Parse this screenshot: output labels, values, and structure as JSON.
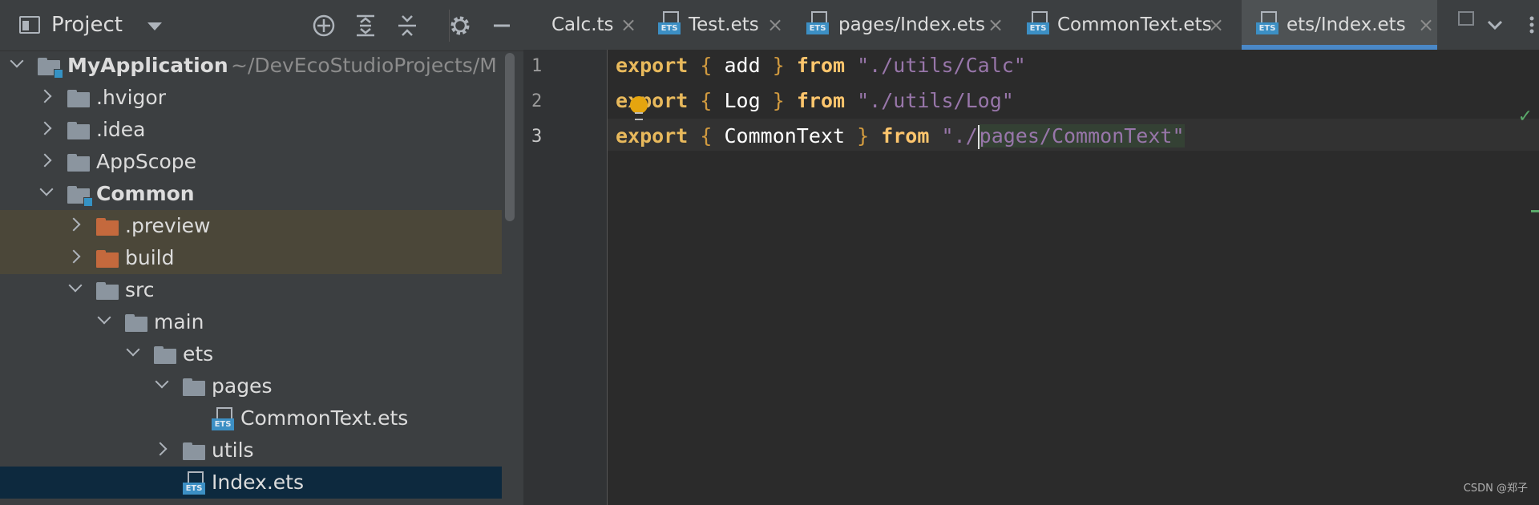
{
  "project_panel": {
    "title": "Project",
    "icons": {
      "view": "panel-icon",
      "dropdown": "chevron-down-icon",
      "locate": "crosshair-icon",
      "expand_all": "expand-all-icon",
      "collapse_all": "collapse-all-icon",
      "settings": "gear-icon",
      "hide": "minimize-icon"
    },
    "root": {
      "name": "MyApplication",
      "path": "~/DevEcoStudioProjects/M"
    },
    "items": [
      {
        "label": ".hvigor"
      },
      {
        "label": ".idea"
      },
      {
        "label": "AppScope"
      },
      {
        "label": "Common"
      },
      {
        "label": ".preview"
      },
      {
        "label": "build"
      },
      {
        "label": "src"
      },
      {
        "label": "main"
      },
      {
        "label": "ets"
      },
      {
        "label": "pages"
      },
      {
        "label": "CommonText.ets",
        "badge": "ETS"
      },
      {
        "label": "utils"
      },
      {
        "label": "Index.ets",
        "badge": "ETS"
      }
    ],
    "colors": {
      "excluded_folder": "#c4693d",
      "selection": "#0d293e",
      "highlight": "#4b4739"
    }
  },
  "editor": {
    "tabs": [
      {
        "label": "Calc.ts",
        "close": "×"
      },
      {
        "label": "Test.ets",
        "close": "×",
        "badge": "ETS"
      },
      {
        "label": "pages/Index.ets",
        "close": "×",
        "badge": "ETS"
      },
      {
        "label": "CommonText.ets",
        "close": "×",
        "badge": "ETS"
      },
      {
        "label": "ets/Index.ets",
        "close": "×",
        "badge": "ETS",
        "active": true
      }
    ],
    "more_tabs_icon": "chevron-down-icon",
    "active_tab_color": "#4a88c7",
    "line_numbers": [
      "1",
      "2",
      "3"
    ],
    "lines": [
      {
        "kw": "export",
        "open": "{",
        "name": "add",
        "close": "}",
        "from": "from",
        "path": "\"./utils/Calc\""
      },
      {
        "kw": "export",
        "open": "{",
        "name": "Log",
        "close": "}",
        "from": "from",
        "path": "\"./utils/Log\""
      },
      {
        "kw": "export",
        "open": "{",
        "name": "CommonText",
        "close": "}",
        "from": "from",
        "path_a": "\"./",
        "path_b": "pages/CommonText\""
      }
    ],
    "status_icon": "check-icon",
    "status_glyph": "✓"
  },
  "watermark": "CSDN @郑子"
}
